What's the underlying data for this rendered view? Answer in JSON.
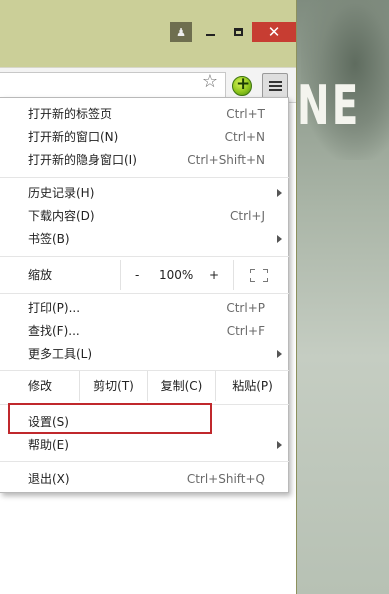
{
  "menu": {
    "items": [
      {
        "label": "打开新的标签页",
        "shortcut": "Ctrl+T"
      },
      {
        "label": "打开新的窗口(N)",
        "shortcut": "Ctrl+N"
      },
      {
        "label": "打开新的隐身窗口(I)",
        "shortcut": "Ctrl+Shift+N"
      },
      {
        "label": "历史记录(H)",
        "shortcut": ""
      },
      {
        "label": "下载内容(D)",
        "shortcut": "Ctrl+J"
      },
      {
        "label": "书签(B)",
        "shortcut": ""
      },
      {
        "label": "打印(P)...",
        "shortcut": "Ctrl+P"
      },
      {
        "label": "查找(F)...",
        "shortcut": "Ctrl+F"
      },
      {
        "label": "更多工具(L)",
        "shortcut": ""
      },
      {
        "label": "设置(S)",
        "shortcut": ""
      },
      {
        "label": "帮助(E)",
        "shortcut": ""
      },
      {
        "label": "退出(X)",
        "shortcut": "Ctrl+Shift+Q"
      }
    ],
    "zoom": {
      "label": "缩放",
      "minus": "-",
      "value": "100%",
      "plus": "+"
    },
    "edit": {
      "label": "修改",
      "cut": "剪切(T)",
      "copy": "复制(C)",
      "paste": "粘贴(P)"
    }
  },
  "background": {
    "poster_text": "NE"
  },
  "colors": {
    "highlight_box": "#c0282c",
    "close_button": "#c73d32",
    "window_frame": "#cbcf98"
  }
}
